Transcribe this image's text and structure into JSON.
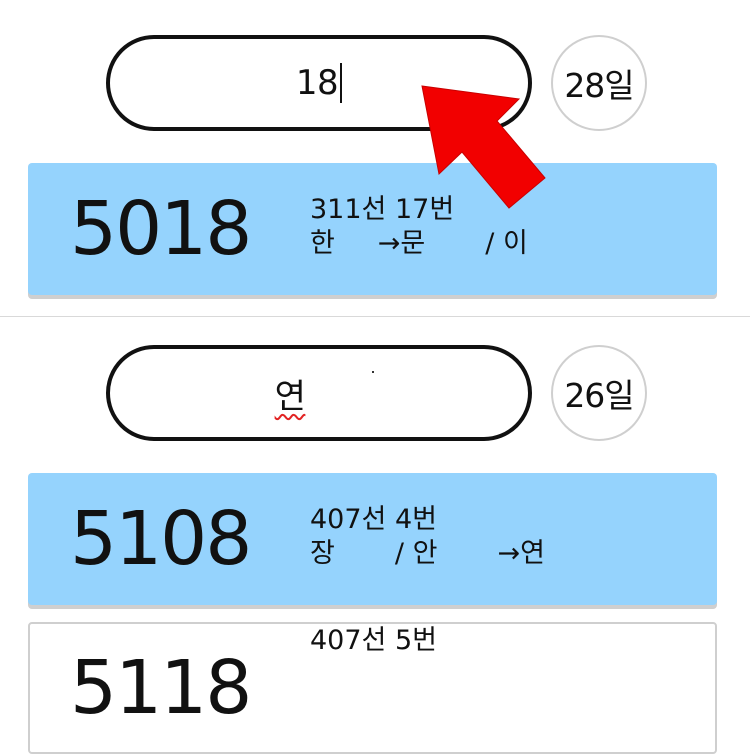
{
  "entries": [
    {
      "search_value": "18",
      "day_label": "28일",
      "card": {
        "number": "5018",
        "line1": "311선 17번",
        "line2": "한     →문       / 이"
      }
    },
    {
      "search_value": "연",
      "day_label": "26일",
      "card": {
        "number": "5108",
        "line1": "407선 4번",
        "line2": "장       / 안       →연"
      }
    },
    {
      "card": {
        "number": "5118",
        "line1": "407선 5번"
      }
    }
  ],
  "colors": {
    "card_active": "#95d3fd",
    "pill_border": "#111111",
    "circle_border": "#cfcfcf",
    "arrow": "#f20000",
    "spellcheck": "#e22424"
  },
  "icons": {
    "annotation": "red-arrow-icon"
  }
}
